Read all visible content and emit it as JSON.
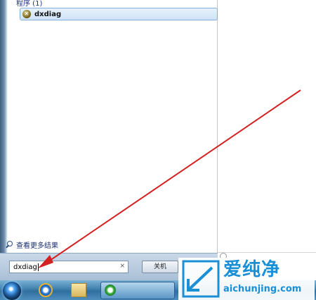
{
  "start_menu": {
    "section_header": "程序 (1)",
    "results": [
      {
        "label": "dxdiag",
        "icon": "dxdiag-icon"
      }
    ],
    "see_more_results": "查看更多结果",
    "search": {
      "value": "dxdiag",
      "clear_glyph": "×"
    },
    "shutdown_label": "关机"
  },
  "watermark": {
    "brand": "爱纯净",
    "url": "aichunjing.com",
    "color": "#1a8fd6"
  },
  "annotation": {
    "color": "#d42020"
  }
}
